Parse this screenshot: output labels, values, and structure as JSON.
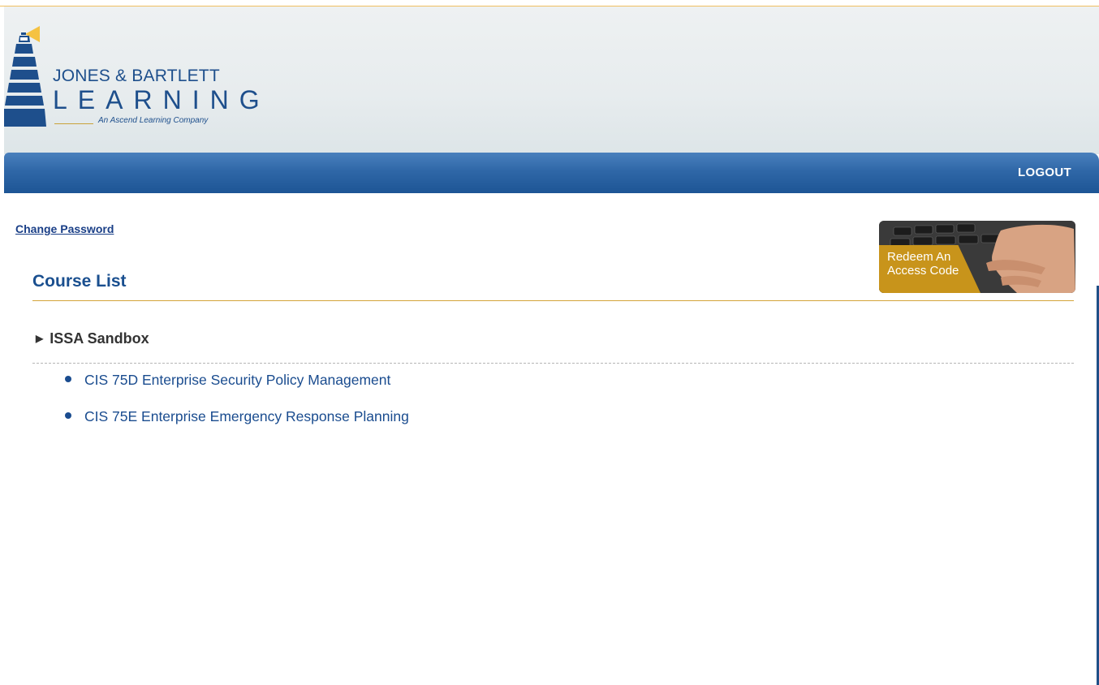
{
  "brand": {
    "name_line1": "JONES & BARTLETT",
    "name_line2": "LEARNING",
    "tagline": "An Ascend Learning Company"
  },
  "nav": {
    "logout_label": "LOGOUT"
  },
  "account": {
    "change_password_label": "Change Password"
  },
  "promo": {
    "redeem_label": "Redeem An Access Code"
  },
  "courses": {
    "title": "Course List",
    "groups": [
      {
        "name": "ISSA Sandbox",
        "items": [
          "CIS 75D Enterprise Security Policy Management",
          "CIS 75E Enterprise Emergency Response Planning"
        ]
      }
    ]
  },
  "colors": {
    "brand_blue": "#1e4f8c",
    "nav_blue": "#2f67a7",
    "accent_gold": "#d4a43a",
    "link_blue": "#1a4c8f"
  }
}
